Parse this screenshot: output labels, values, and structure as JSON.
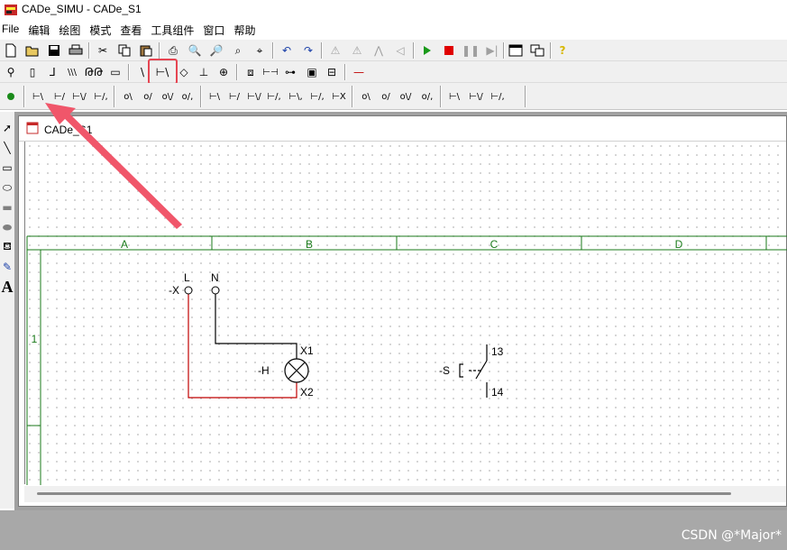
{
  "window": {
    "title": "CADe_SIMU - CADe_S1"
  },
  "menu": [
    "File",
    "编辑",
    "绘图",
    "模式",
    "查看",
    "工具组件",
    "窗口",
    "帮助"
  ],
  "toolbar1": {
    "icons": [
      "new-icon",
      "open-icon",
      "save-icon",
      "print-icon",
      "cut-icon",
      "copy-icon",
      "paste-icon",
      "print-preview-icon",
      "zoom-in-icon",
      "zoom-out-icon",
      "zoom-fit-icon",
      "undo-icon",
      "redo-icon",
      "flip-icon",
      "mirror-icon",
      "rotate-icon",
      "move-icon",
      "play-icon",
      "stop-icon",
      "pause-icon",
      "step-icon",
      "window-icon",
      "windows-icon",
      "help-icon"
    ],
    "colors": {
      "play": "#1a9a1a",
      "stop": "#e00000",
      "help": "#d8b800"
    }
  },
  "toolbar2": {
    "icons": [
      "terminal-icon",
      "fuse-icon",
      "switch-icon",
      "three-pole-switch-icon",
      "motor-icon",
      "relay-icon",
      "contact-no-icon",
      "pushbutton-no-icon",
      "diamond-icon",
      "cross-icon",
      "cross-box-icon",
      "sensor-icon",
      "resistor-icon",
      "coil-icon",
      "box-icon",
      "connector-icon",
      "wire-icon"
    ],
    "highlighted_icon": "pushbutton-no-icon",
    "highlight_color": "#e64552"
  },
  "toolbar3": {
    "dot_color": "#1a8a1a",
    "icons": [
      "nc-contact-icon",
      "no-contact-icon",
      "nc-contact-pair-icon",
      "no-contact-pair-icon",
      "timer-nc-icon",
      "timer-no-icon",
      "timer-nc-pair-icon",
      "timer-no-pair-icon",
      "three-contact-a-icon",
      "three-contact-b-icon",
      "three-contact-c-icon",
      "three-contact-d-icon",
      "three-contact-e-icon",
      "three-contact-f-icon",
      "three-contact-g-icon",
      "aux-nc-icon",
      "aux-no-icon",
      "aux-nc-pair-icon",
      "aux-no-pair-icon",
      "limit-a-icon",
      "limit-b-icon",
      "limit-c-icon"
    ]
  },
  "left_tools": [
    "select-arrow-icon",
    "line-icon",
    "rectangle-icon",
    "ellipse-icon",
    "filled-rectangle-icon",
    "filled-ellipse-icon",
    "fill-icon",
    "pen-icon",
    "text-icon"
  ],
  "left_tools_text_glyph": "A",
  "document": {
    "title": "CADe_S1",
    "grid_columns": [
      "A",
      "B",
      "C",
      "D"
    ],
    "grid_rows": [
      "1"
    ],
    "grid_color": "#1a7a1a",
    "circuit": {
      "terminal_x_label": "-X",
      "terminal_l_label": "L",
      "terminal_n_label": "N",
      "lamp_label": "-H",
      "lamp_pin_top": "X1",
      "lamp_pin_bottom": "X2",
      "switch_label": "-S",
      "switch_pin_top": "13",
      "switch_pin_bottom": "14",
      "wire_l_color": "#c00000",
      "wire_n_color": "#000000"
    }
  },
  "annotation": {
    "arrow_color": "#f0566a"
  },
  "watermark": "CSDN @*Major*"
}
